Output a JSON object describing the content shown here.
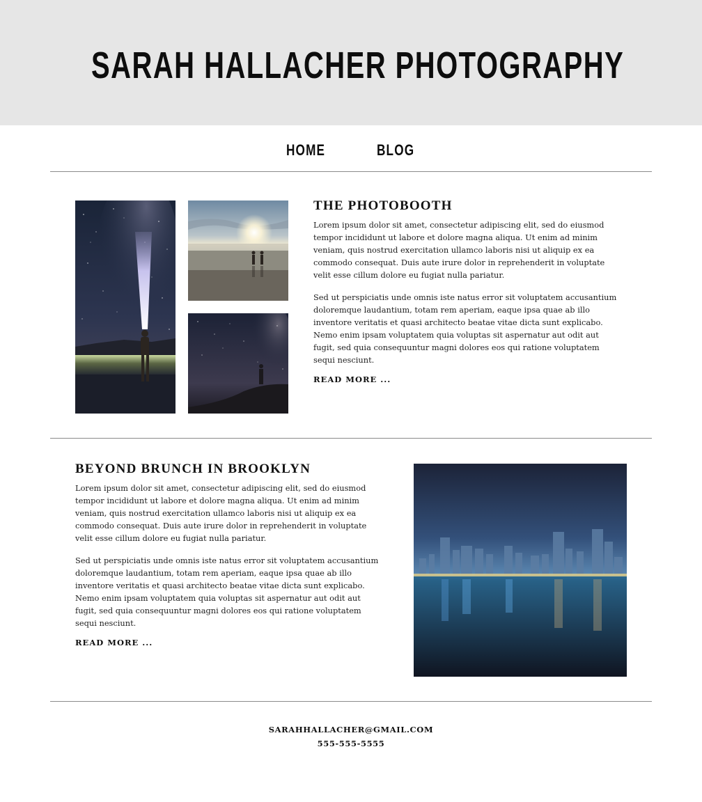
{
  "site": {
    "title": "SARAH HALLACHER PHOTOGRAPHY"
  },
  "nav": {
    "items": [
      {
        "label": "HOME"
      },
      {
        "label": "BLOG"
      }
    ]
  },
  "posts": [
    {
      "title": "THE PHOTOBOOTH",
      "paragraphs": [
        "Lorem ipsum dolor sit amet, consectetur adipiscing elit, sed do eiusmod tempor incididunt ut labore et dolore magna aliqua. Ut enim ad minim veniam, quis nostrud exercitation ullamco laboris nisi ut aliquip ex ea commodo consequat. Duis aute irure dolor in reprehenderit in voluptate velit esse cillum dolore eu fugiat nulla pariatur.",
        "Sed ut perspiciatis unde omnis iste natus error sit voluptatem accusantium doloremque laudantium, totam rem aperiam, eaque ipsa quae ab illo inventore veritatis et quasi architecto beatae vitae dicta sunt explicabo. Nemo enim ipsam voluptatem quia voluptas sit aspernatur aut odit aut fugit, sed quia consequuntur magni dolores eos qui ratione voluptatem sequi nesciunt."
      ],
      "read_more": "READ MORE ..."
    },
    {
      "title": "BEYOND BRUNCH IN BROOKLYN",
      "paragraphs": [
        "Lorem ipsum dolor sit amet, consectetur adipiscing elit, sed do eiusmod tempor incididunt ut labore et dolore magna aliqua. Ut enim ad minim veniam, quis nostrud exercitation ullamco laboris nisi ut aliquip ex ea commodo consequat. Duis aute irure dolor in reprehenderit in voluptate velit esse cillum dolore eu fugiat nulla pariatur.",
        "Sed ut perspiciatis unde omnis iste natus error sit voluptatem accusantium doloremque laudantium, totam rem aperiam, eaque ipsa quae ab illo inventore veritatis et quasi architecto beatae vitae dicta sunt explicabo. Nemo enim ipsam voluptatem quia voluptas sit aspernatur aut odit aut fugit, sed quia consequuntur magni dolores eos qui ratione voluptatem sequi nesciunt."
      ],
      "read_more": "READ MORE ..."
    }
  ],
  "footer": {
    "email": "SARAHHALLACHER@GMAIL.COM",
    "phone": "555-555-5555"
  },
  "colors": {
    "header_bg": "#e6e6e6",
    "rule": "#8a8a8a",
    "text": "#1a1a1a"
  }
}
